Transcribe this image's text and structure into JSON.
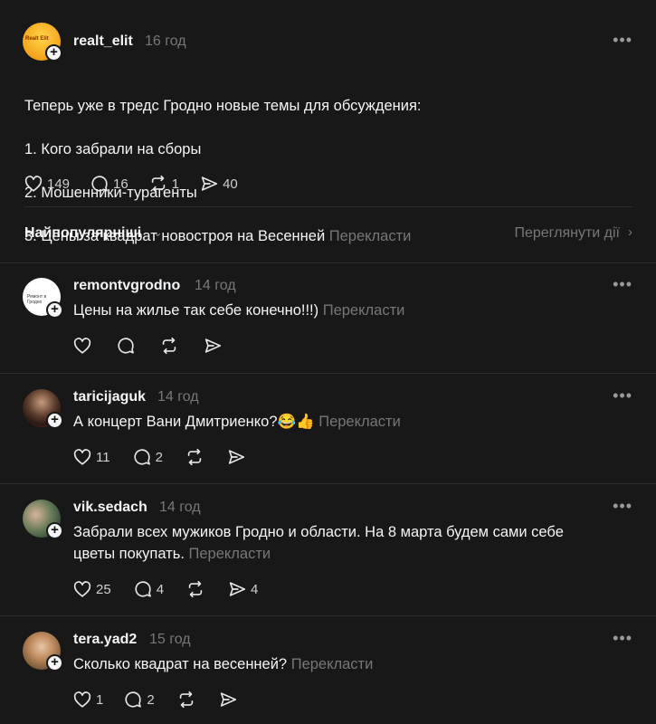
{
  "main_post": {
    "username": "realt_elit",
    "time": "16 год",
    "avatar_text": "Realt Elit",
    "lines": [
      "Теперь уже в тредс Гродно новые темы для обсуждения:",
      "1. Кого забрали на сборы",
      "2. Мошенники-турагенты",
      "3. Цены за квадрат новостроя на Весенней"
    ],
    "translate": "Перекласти",
    "likes": "149",
    "comments": "16",
    "reposts": "1",
    "shares": "40"
  },
  "sort": {
    "label": "Найпопулярніші",
    "view_activity": "Переглянути дії"
  },
  "replies": [
    {
      "username": "remontvgrodno",
      "time": "14 год",
      "avatar_text": "Ремонт в Гродно",
      "text": "Цены на жилье так себе конечно!!!)",
      "translate": "Перекласти",
      "likes": "",
      "comments": "",
      "shares": ""
    },
    {
      "username": "taricijaguk",
      "time": "14 год",
      "text": "А концерт Вани Дмитриенко?😂👍",
      "translate": "Перекласти",
      "likes": "11",
      "comments": "2",
      "shares": ""
    },
    {
      "username": "vik.sedach",
      "time": "14 год",
      "text": "Забрали всех мужиков Гродно и области. На 8 марта будем сами себе\nцветы покупать.",
      "translate": "Перекласти",
      "likes": "25",
      "comments": "4",
      "shares": "4"
    },
    {
      "username": "tera.yad2",
      "time": "15 год",
      "text": "Сколько квадрат на весенней?",
      "translate": "Перекласти",
      "likes": "1",
      "comments": "2",
      "shares": ""
    }
  ],
  "icons": [
    "heart-icon",
    "comment-icon",
    "repost-icon",
    "share-icon",
    "more-icon",
    "plus-icon",
    "chevron-down-icon",
    "chevron-right-icon"
  ]
}
